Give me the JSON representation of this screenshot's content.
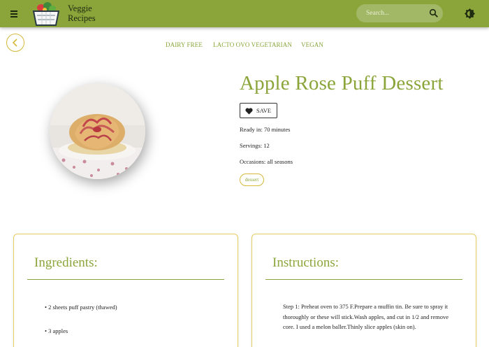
{
  "header": {
    "brand_line1": "Veggie",
    "brand_line2": "Recipes",
    "search_placeholder": "Search...",
    "bar_color": "#8ba53a"
  },
  "diet_tags": [
    "DAIRY FREE",
    "LACTO OVO VEGETARIAN",
    "VEGAN"
  ],
  "recipe": {
    "title": "Apple Rose Puff Dessert",
    "save_label": "SAVE",
    "ready_in": "Ready in: 70 minutes",
    "servings": "Servings: 12",
    "occasions": "Occasions: all seasons",
    "dish_type": "dessert"
  },
  "ingredients": {
    "heading": "Ingredients:",
    "items": [
      "• 2 sheets puff pastry (thawed)",
      "• 3 apples"
    ]
  },
  "instructions": {
    "heading": "Instructions:",
    "step1": "Step 1: Preheat oven to 375 F.Prepare a muffin tin. Be sure to spray it thoroughly or these will stick.Wash apples, and cut in 1/2 and remove core. I used a melon baller.Thinly slice apples (skin on)."
  }
}
